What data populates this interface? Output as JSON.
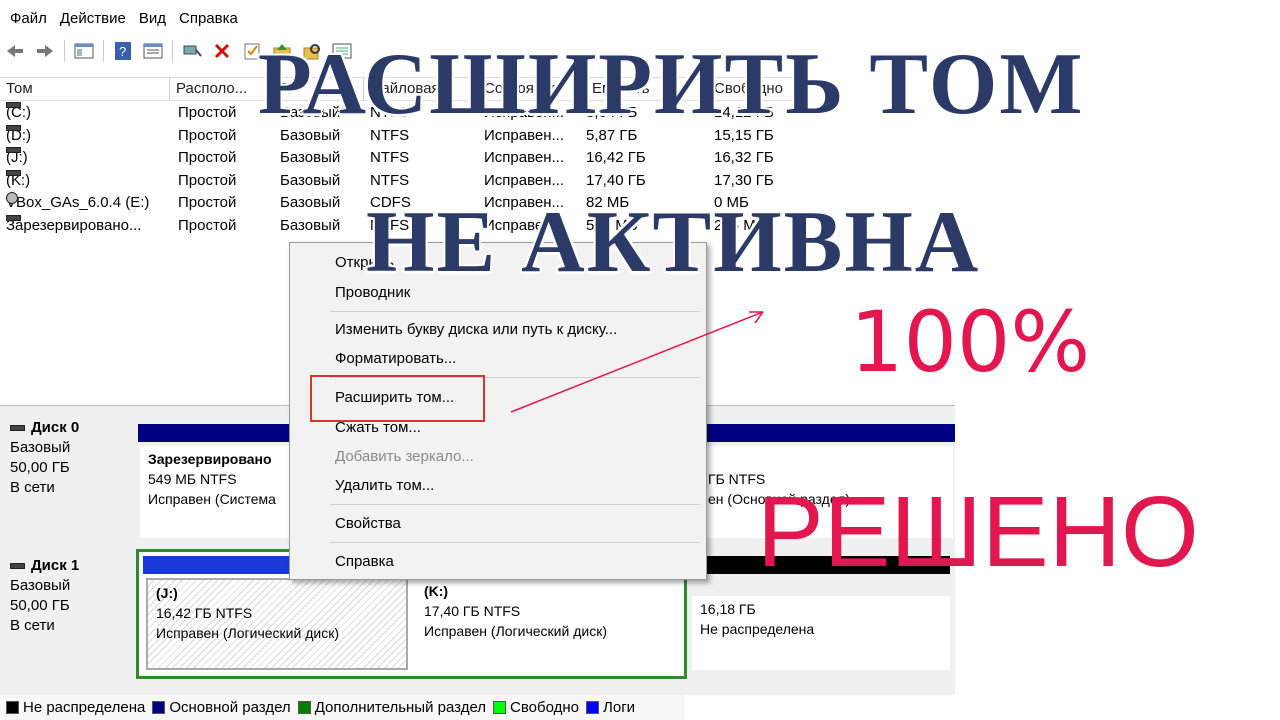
{
  "menubar": {
    "items": [
      "Файл",
      "Действие",
      "Вид",
      "Справка"
    ]
  },
  "toolbar": {
    "icons": [
      "back-icon",
      "forward-icon",
      "console-tree-icon",
      "help-icon",
      "properties-icon",
      "connect-icon",
      "delete-icon",
      "checklist-icon",
      "up-folder-icon",
      "search-folder-icon",
      "list-view-icon"
    ]
  },
  "columns": [
    "Том",
    "Располо...",
    "Т",
    "Файловая",
    "Состояние",
    "Емкость",
    "Свободно"
  ],
  "volumes": [
    {
      "name": "(C:)",
      "layout": "Простой",
      "type": "Базовый",
      "fs": "NTFS",
      "status": "Исправен...",
      "capacity": "3,64 ГБ",
      "free": "14,12 ГБ"
    },
    {
      "name": "(D:)",
      "layout": "Простой",
      "type": "Базовый",
      "fs": "NTFS",
      "status": "Исправен...",
      "capacity": "5,87 ГБ",
      "free": "15,15 ГБ"
    },
    {
      "name": "(J:)",
      "layout": "Простой",
      "type": "Базовый",
      "fs": "NTFS",
      "status": "Исправен...",
      "capacity": "16,42 ГБ",
      "free": "16,32 ГБ"
    },
    {
      "name": "(K:)",
      "layout": "Простой",
      "type": "Базовый",
      "fs": "NTFS",
      "status": "Исправен...",
      "capacity": "17,40 ГБ",
      "free": "17,30 ГБ"
    },
    {
      "name": "VBox_GAs_6.0.4 (E:)",
      "layout": "Простой",
      "type": "Базовый",
      "fs": "CDFS",
      "status": "Исправен...",
      "capacity": "82 МБ",
      "free": "0 МБ"
    },
    {
      "name": "Зарезервировано...",
      "layout": "Простой",
      "type": "Базовый",
      "fs": "NTFS",
      "status": "Исправен...",
      "capacity": "549 МБ",
      "free": "225 МБ"
    }
  ],
  "disks": [
    {
      "title": "Диск 0",
      "type": "Базовый",
      "size": "50,00 ГБ",
      "state": "В сети",
      "partitions": [
        {
          "title": "Зарезервировано",
          "size": "549 МБ NTFS",
          "status": "Исправен (Система"
        },
        {
          "title": "",
          "size": "ГБ NTFS",
          "status": "ен (Основной раздел)"
        }
      ]
    },
    {
      "title": "Диск 1",
      "type": "Базовый",
      "size": "50,00 ГБ",
      "state": "В сети",
      "partitions": [
        {
          "title": "(J:)",
          "size": "16,42 ГБ NTFS",
          "status": "Исправен (Логический диск)"
        },
        {
          "title": "(K:)",
          "size": "17,40 ГБ NTFS",
          "status": "Исправен (Логический диск)"
        },
        {
          "title": "",
          "size": "16,18 ГБ",
          "status": "Не распределена"
        }
      ]
    }
  ],
  "context_menu": {
    "open": "Открыть",
    "explorer": "Проводник",
    "change_letter": "Изменить букву диска или путь к диску...",
    "format": "Форматировать...",
    "extend": "Расширить том...",
    "shrink": "Сжать том...",
    "add_mirror": "Добавить зеркало...",
    "delete": "Удалить том...",
    "properties": "Свойства",
    "help": "Справка"
  },
  "legend": [
    {
      "label": "Не распределена",
      "color": "#000000"
    },
    {
      "label": "Основной раздел",
      "color": "#000080"
    },
    {
      "label": "Дополнительный раздел",
      "color": "#008000"
    },
    {
      "label": "Свободно",
      "color": "#00ff00"
    },
    {
      "label": "Логи",
      "color": "#0000ff"
    }
  ],
  "overlay": {
    "line1": "РАСШИРИТЬ ТОМ",
    "line2": "НЕ АКТИВНА",
    "percent": "100%",
    "solved": "РЕШЕНО"
  },
  "colors": {
    "title_blue": "#2b3a66",
    "accent_red": "#e3174f",
    "highlight_box": "#d9342b"
  }
}
